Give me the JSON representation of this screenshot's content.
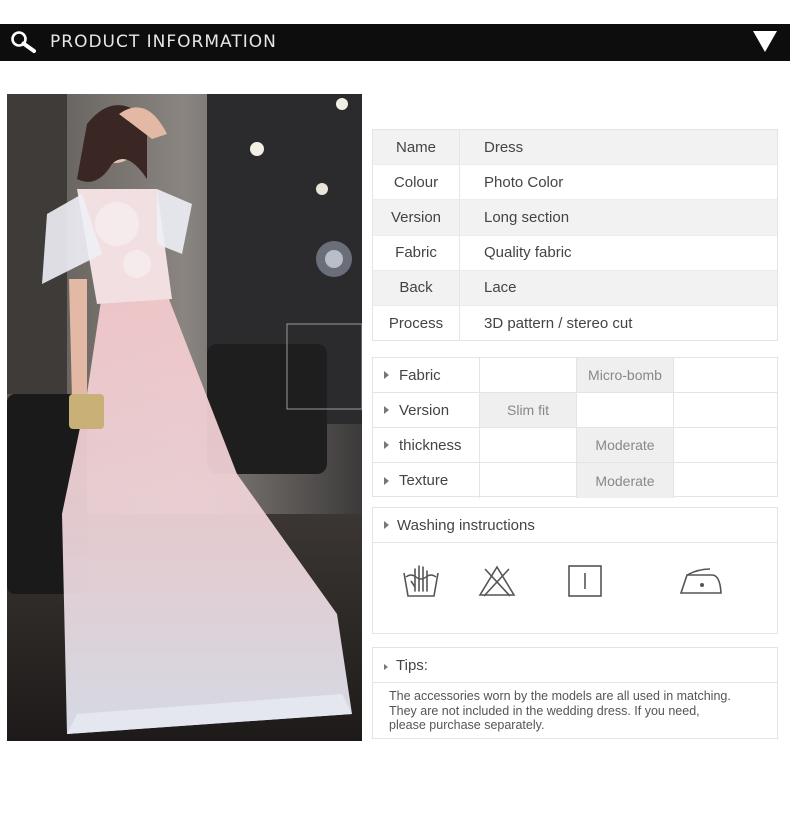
{
  "header": {
    "title": "PRODUCT INFORMATION",
    "search_icon": "search-icon",
    "collapse_icon": "triangle-down-icon"
  },
  "photo": {
    "subject": "product-photo"
  },
  "specs": [
    {
      "key": "Name",
      "value": "Dress"
    },
    {
      "key": "Colour",
      "value": "Photo Color"
    },
    {
      "key": "Version",
      "value": "Long section"
    },
    {
      "key": "Fabric",
      "value": "Quality fabric"
    },
    {
      "key": "Back",
      "value": "Lace"
    },
    {
      "key": "Process",
      "value": "3D pattern / stereo cut"
    }
  ],
  "attributes": [
    {
      "label": "Fabric",
      "cells": [
        "",
        "Micro-bomb",
        ""
      ]
    },
    {
      "label": "Version",
      "cells": [
        "Slim fit",
        "",
        ""
      ]
    },
    {
      "label": "thickness",
      "cells": [
        "",
        "Moderate",
        ""
      ]
    },
    {
      "label": "Texture",
      "cells": [
        "",
        "Moderate",
        ""
      ]
    }
  ],
  "washing": {
    "title": "Washing instructions",
    "icons": [
      "hand-wash-icon",
      "do-not-bleach-icon",
      "hang-dry-icon",
      "low-iron-icon"
    ]
  },
  "tips": {
    "title": "Tips:",
    "lines": [
      "The accessories worn by the models are all used in matching.",
      "They are not included in the wedding dress. If you need,",
      "please purchase separately."
    ]
  }
}
